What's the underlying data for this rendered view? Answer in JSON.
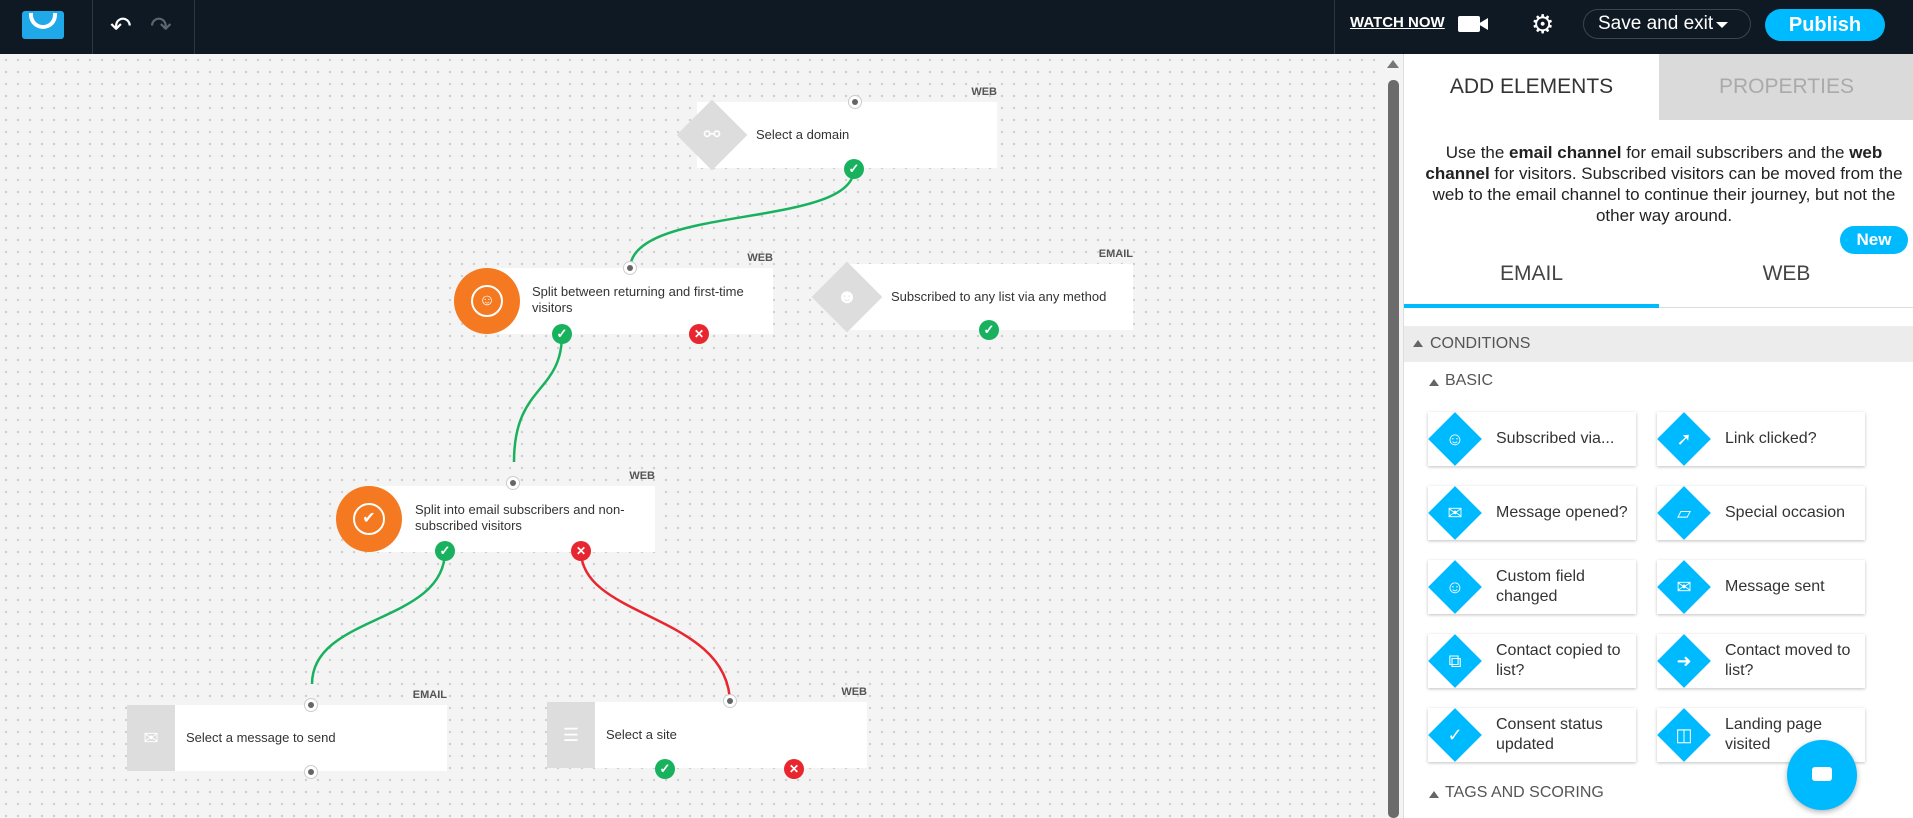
{
  "topbar": {
    "undo_icon": "undo-icon",
    "redo_icon": "redo-icon",
    "watch_now": "WATCH NOW",
    "save_and_exit": "Save and exit",
    "publish": "Publish"
  },
  "nodes": {
    "domain": {
      "label": "Select a domain",
      "channel": "WEB"
    },
    "split_returning": {
      "label": "Split between returning and first-time visitors",
      "channel": "WEB"
    },
    "subscribed_any": {
      "label": "Subscribed to any list via any method",
      "channel": "EMAIL"
    },
    "split_email": {
      "label": "Split into email subscribers and non-subscribed visitors",
      "channel": "WEB"
    },
    "select_message": {
      "label": "Select a message to send",
      "channel": "EMAIL"
    },
    "select_site": {
      "label": "Select a site",
      "channel": "WEB"
    }
  },
  "panel": {
    "tabs": [
      "ADD ELEMENTS",
      "PROPERTIES"
    ],
    "desc": {
      "p1": "Use the ",
      "b1": "email channel",
      "p2": " for email subscribers and the ",
      "b2": "web channel",
      "p3": " for visitors. Subscribed visitors can be moved from the web to the email channel to continue their journey, but not the other way around."
    },
    "channel_tabs": [
      "EMAIL",
      "WEB"
    ],
    "new_badge": "New",
    "conditions": "CONDITIONS",
    "basic": "BASIC",
    "tags_scoring": "TAGS AND SCORING",
    "cards": [
      "Subscribed via...",
      "Link clicked?",
      "Message opened?",
      "Special occasion",
      "Custom field changed",
      "Message sent",
      "Contact copied to list?",
      "Contact moved to list?",
      "Consent status updated",
      "Landing page visited"
    ]
  },
  "colors": {
    "topbar": "#0f1923",
    "accent": "#00baff",
    "orange": "#f47920",
    "success": "#18b25e",
    "fail": "#e8262f"
  }
}
